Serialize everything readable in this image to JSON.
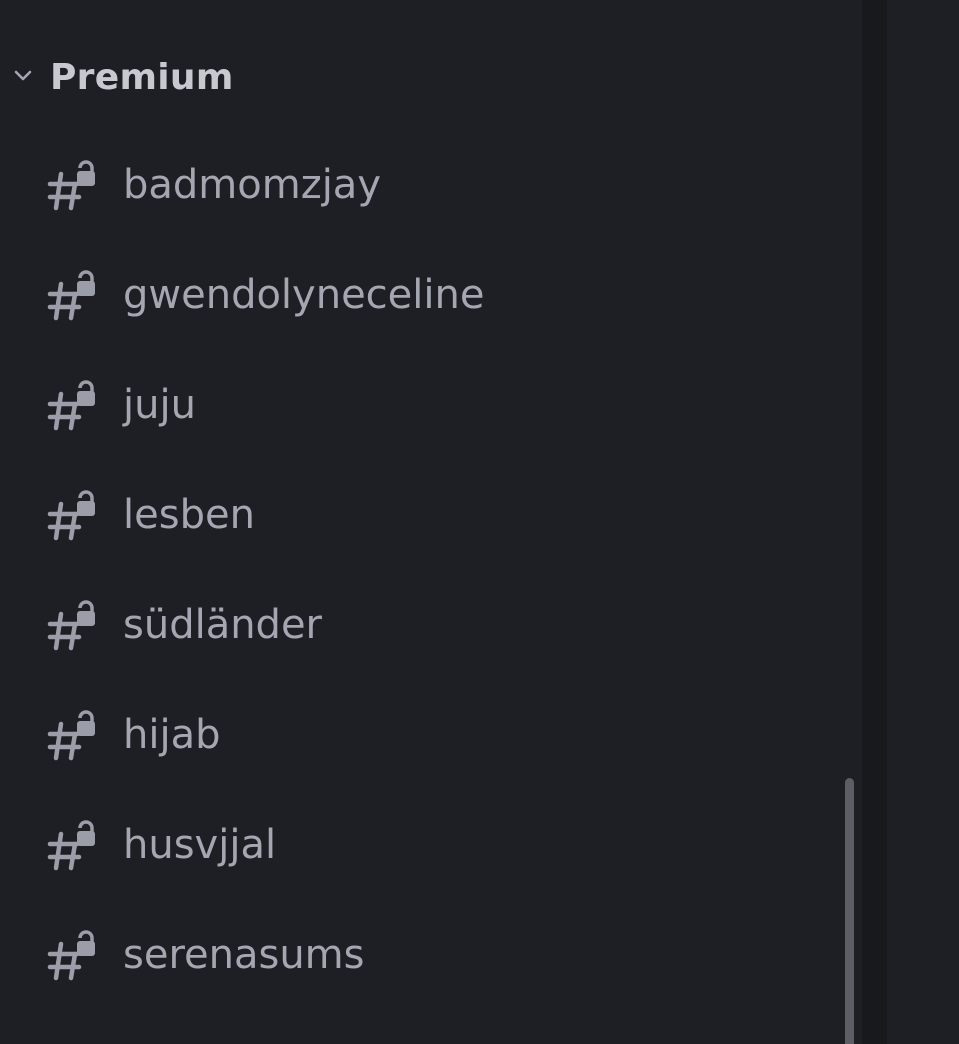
{
  "category": {
    "title": "Premium",
    "chevron_icon": "chevron-down-icon",
    "collapsed": false
  },
  "channels": [
    {
      "name": "badmomzjay",
      "icon": "locked-text-channel-icon"
    },
    {
      "name": "gwendolyneceline",
      "icon": "locked-text-channel-icon"
    },
    {
      "name": "juju",
      "icon": "locked-text-channel-icon"
    },
    {
      "name": "lesben",
      "icon": "locked-text-channel-icon"
    },
    {
      "name": "südländer",
      "icon": "locked-text-channel-icon"
    },
    {
      "name": "hijab",
      "icon": "locked-text-channel-icon"
    },
    {
      "name": "husvjjal",
      "icon": "locked-text-channel-icon"
    },
    {
      "name": "serenasums",
      "icon": "locked-text-channel-icon"
    }
  ],
  "colors": {
    "background": "#1e1f24",
    "divider": "#18191d",
    "category_text": "#c7c9d1",
    "channel_text": "#a4a7b1",
    "icon": "#9b9ea8",
    "scrollbar_thumb": "#5c5e66"
  }
}
